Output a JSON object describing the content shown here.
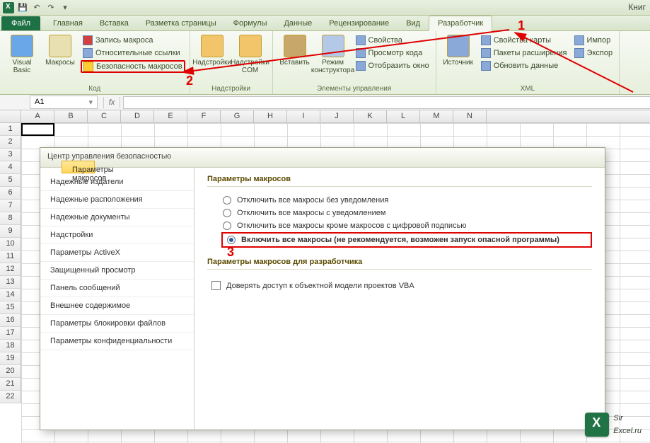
{
  "app_title_fragment": "Книг",
  "tabs": {
    "file": "Файл",
    "home": "Главная",
    "insert": "Вставка",
    "layout": "Разметка страницы",
    "formulas": "Формулы",
    "data": "Данные",
    "review": "Рецензирование",
    "view": "Вид",
    "developer": "Разработчик"
  },
  "ribbon": {
    "code": {
      "label": "Код",
      "visual_basic": "Visual Basic",
      "macros": "Макросы",
      "record_macro": "Запись макроса",
      "relative_refs": "Относительные ссылки",
      "macro_security": "Безопасность макросов"
    },
    "addins": {
      "label": "Надстройки",
      "addins": "Надстройки",
      "com_addins": "Надстройки COM"
    },
    "controls": {
      "label": "Элементы управления",
      "insert": "Вставить",
      "design_mode": "Режим конструктора",
      "properties": "Свойства",
      "view_code": "Просмотр кода",
      "run_dialog": "Отобразить окно"
    },
    "xml": {
      "label": "XML",
      "source": "Источник",
      "map_props": "Свойства карты",
      "expansion": "Пакеты расширения",
      "refresh": "Обновить данные",
      "import": "Импор",
      "export": "Экспор"
    }
  },
  "namebox": "A1",
  "columns": [
    "A",
    "B",
    "C",
    "D",
    "E",
    "F",
    "G",
    "H",
    "I",
    "J",
    "K",
    "L",
    "M",
    "N"
  ],
  "rows": [
    "1",
    "2",
    "3",
    "4",
    "5",
    "6",
    "7",
    "8",
    "9",
    "10",
    "11",
    "12",
    "13",
    "14",
    "15",
    "16",
    "17",
    "18",
    "19",
    "20",
    "21",
    "22"
  ],
  "dialog": {
    "title": "Центр управления безопасностью",
    "nav": [
      "Надежные издатели",
      "Надежные расположения",
      "Надежные документы",
      "Надстройки",
      "Параметры ActiveX",
      "Параметры макросов",
      "Защищенный просмотр",
      "Панель сообщений",
      "Внешнее содержимое",
      "Параметры блокировки файлов",
      "Параметры конфиденциальности"
    ],
    "section1": "Параметры макросов",
    "opt1": "Отключить все макросы без уведомления",
    "opt2": "Отключить все макросы с уведомлением",
    "opt3": "Отключить все макросы кроме макросов с цифровой подписью",
    "opt4": "Включить все макросы (не рекомендуется, возможен запуск опасной программы)",
    "section2": "Параметры макросов для разработчика",
    "chk1": "Доверять доступ к объектной модели проектов VBA"
  },
  "annotations": {
    "n1": "1",
    "n2": "2",
    "n3": "3"
  },
  "watermark": {
    "line1": "Sir",
    "line2": "Excel.ru"
  }
}
